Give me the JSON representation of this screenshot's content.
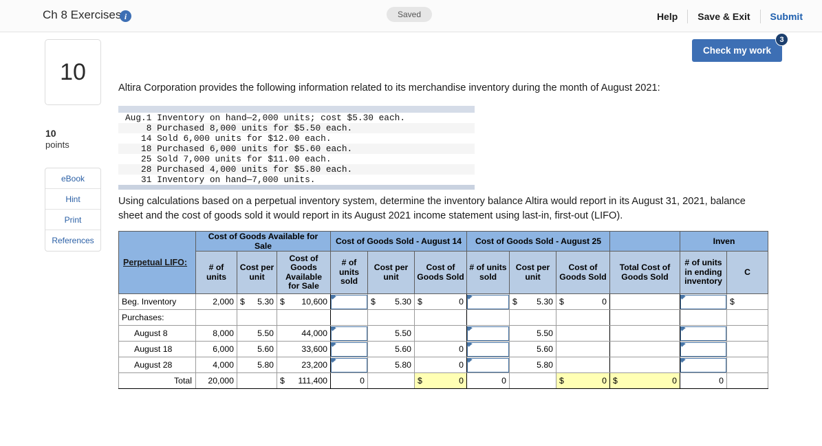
{
  "header": {
    "title": "Ch 8 Exercises",
    "info_icon": "info-icon",
    "saved_label": "Saved",
    "help_label": "Help",
    "save_exit_label": "Save & Exit",
    "submit_label": "Submit",
    "accent_color": "#3d6fb4",
    "link_color": "#1e5fae"
  },
  "check_work": {
    "label": "Check my work",
    "badge": "3",
    "button_color": "#3d6fb4",
    "badge_color": "#1c3f6e"
  },
  "rail": {
    "question_number": "10",
    "points_value": "10",
    "points_label": "points",
    "tools": [
      {
        "label": "eBook"
      },
      {
        "label": "Hint"
      },
      {
        "label": "Print"
      },
      {
        "label": "References"
      }
    ]
  },
  "question": {
    "intro": "Altira Corporation provides the following information related to its merchandise inventory during the month of August 2021:",
    "transactions": [
      "Aug.1 Inventory on hand—2,000 units; cost $5.30 each.",
      "    8 Purchased 8,000 units for $5.50 each.",
      "   14 Sold 6,000 units for $12.00 each.",
      "   18 Purchased 6,000 units for $5.60 each.",
      "   25 Sold 7,000 units for $11.00 each.",
      "   28 Purchased 4,000 units for $5.80 each.",
      "   31 Inventory on hand—7,000 units."
    ],
    "prompt": "Using calculations based on a perpetual inventory system, determine the inventory balance Altira would report in its August 31, 2021, balance sheet and the cost of goods sold it would report in its August 2021 income statement using last-in, first-out (LIFO)."
  },
  "table": {
    "corner_label": "Perpetual LIFO:",
    "group_headers": [
      {
        "label": "Cost of Goods Available for Sale",
        "span": 3
      },
      {
        "label": "Cost of Goods Sold - August 14",
        "span": 3
      },
      {
        "label": "Cost of Goods Sold - August 25",
        "span": 3
      },
      {
        "label": "",
        "span": 1
      },
      {
        "label": "Inven",
        "span": 2
      }
    ],
    "sub_headers": [
      "# of units",
      "Cost per unit",
      "Cost of Goods Available for Sale",
      "# of units sold",
      "Cost per unit",
      "Cost of Goods Sold",
      "# of units sold",
      "Cost per unit",
      "Cost of Goods Sold",
      "Total Cost of Goods Sold",
      "# of units in ending inventory",
      "C"
    ],
    "rows": [
      {
        "label": "Beg. Inventory",
        "indent": false,
        "avail_units": "2,000",
        "avail_cost_dollar": "$",
        "avail_cost": "5.30",
        "avail_total_dollar": "$",
        "avail_total": "10,600",
        "a14_units_input": "",
        "a14_cost_dollar": "$",
        "a14_cost": "5.30",
        "a14_cogs_dollar": "$",
        "a14_cogs": "0",
        "a25_units_input": "",
        "a25_cost_dollar": "$",
        "a25_cost": "5.30",
        "a25_cogs_dollar": "$",
        "a25_cogs": "0",
        "total_cogs": "",
        "end_units_input": "",
        "end_cost_dollar": "$"
      },
      {
        "label": "Purchases:",
        "indent": false,
        "avail_units": "",
        "avail_cost_dollar": "",
        "avail_cost": "",
        "avail_total_dollar": "",
        "avail_total": "",
        "a14_units_input": null,
        "a14_cost_dollar": "",
        "a14_cost": "",
        "a14_cogs_dollar": "",
        "a14_cogs": "",
        "a25_units_input": null,
        "a25_cost_dollar": "",
        "a25_cost": "",
        "a25_cogs_dollar": "",
        "a25_cogs": "",
        "total_cogs": "",
        "end_units_input": null,
        "end_cost_dollar": ""
      },
      {
        "label": "August 8",
        "indent": true,
        "avail_units": "8,000",
        "avail_cost_dollar": "",
        "avail_cost": "5.50",
        "avail_total_dollar": "",
        "avail_total": "44,000",
        "a14_units_input": "",
        "a14_cost_dollar": "",
        "a14_cost": "5.50",
        "a14_cogs_dollar": "",
        "a14_cogs": "",
        "a25_units_input": "",
        "a25_cost_dollar": "",
        "a25_cost": "5.50",
        "a25_cogs_dollar": "",
        "a25_cogs": "",
        "total_cogs": "",
        "end_units_input": "",
        "end_cost_dollar": ""
      },
      {
        "label": "August 18",
        "indent": true,
        "avail_units": "6,000",
        "avail_cost_dollar": "",
        "avail_cost": "5.60",
        "avail_total_dollar": "",
        "avail_total": "33,600",
        "a14_units_input": "",
        "a14_cost_dollar": "",
        "a14_cost": "5.60",
        "a14_cogs_dollar": "",
        "a14_cogs": "0",
        "a25_units_input": "",
        "a25_cost_dollar": "",
        "a25_cost": "5.60",
        "a25_cogs_dollar": "",
        "a25_cogs": "",
        "total_cogs": "",
        "end_units_input": "",
        "end_cost_dollar": ""
      },
      {
        "label": "August 28",
        "indent": true,
        "avail_units": "4,000",
        "avail_cost_dollar": "",
        "avail_cost": "5.80",
        "avail_total_dollar": "",
        "avail_total": "23,200",
        "a14_units_input": "",
        "a14_cost_dollar": "",
        "a14_cost": "5.80",
        "a14_cogs_dollar": "",
        "a14_cogs": "0",
        "a25_units_input": "",
        "a25_cost_dollar": "",
        "a25_cost": "5.80",
        "a25_cogs_dollar": "",
        "a25_cogs": "",
        "total_cogs": "",
        "end_units_input": "",
        "end_cost_dollar": ""
      }
    ],
    "total_row": {
      "label": "Total",
      "avail_units": "20,000",
      "avail_cost": "",
      "avail_total_dollar": "$",
      "avail_total": "111,400",
      "a14_units": "0",
      "a14_cost": "",
      "a14_cogs_dollar": "$",
      "a14_cogs": "0",
      "a25_units": "0",
      "a25_cost": "",
      "a25_cogs_dollar": "$",
      "a25_cogs": "0",
      "total_cogs_dollar": "$",
      "total_cogs": "0",
      "end_units": "0",
      "end_cost": ""
    },
    "colors": {
      "header_blue": "#8db4e2",
      "subheader_blue": "#b8cce4",
      "total_yellow": "#ffffb4",
      "input_border": "#4a77a8"
    }
  }
}
